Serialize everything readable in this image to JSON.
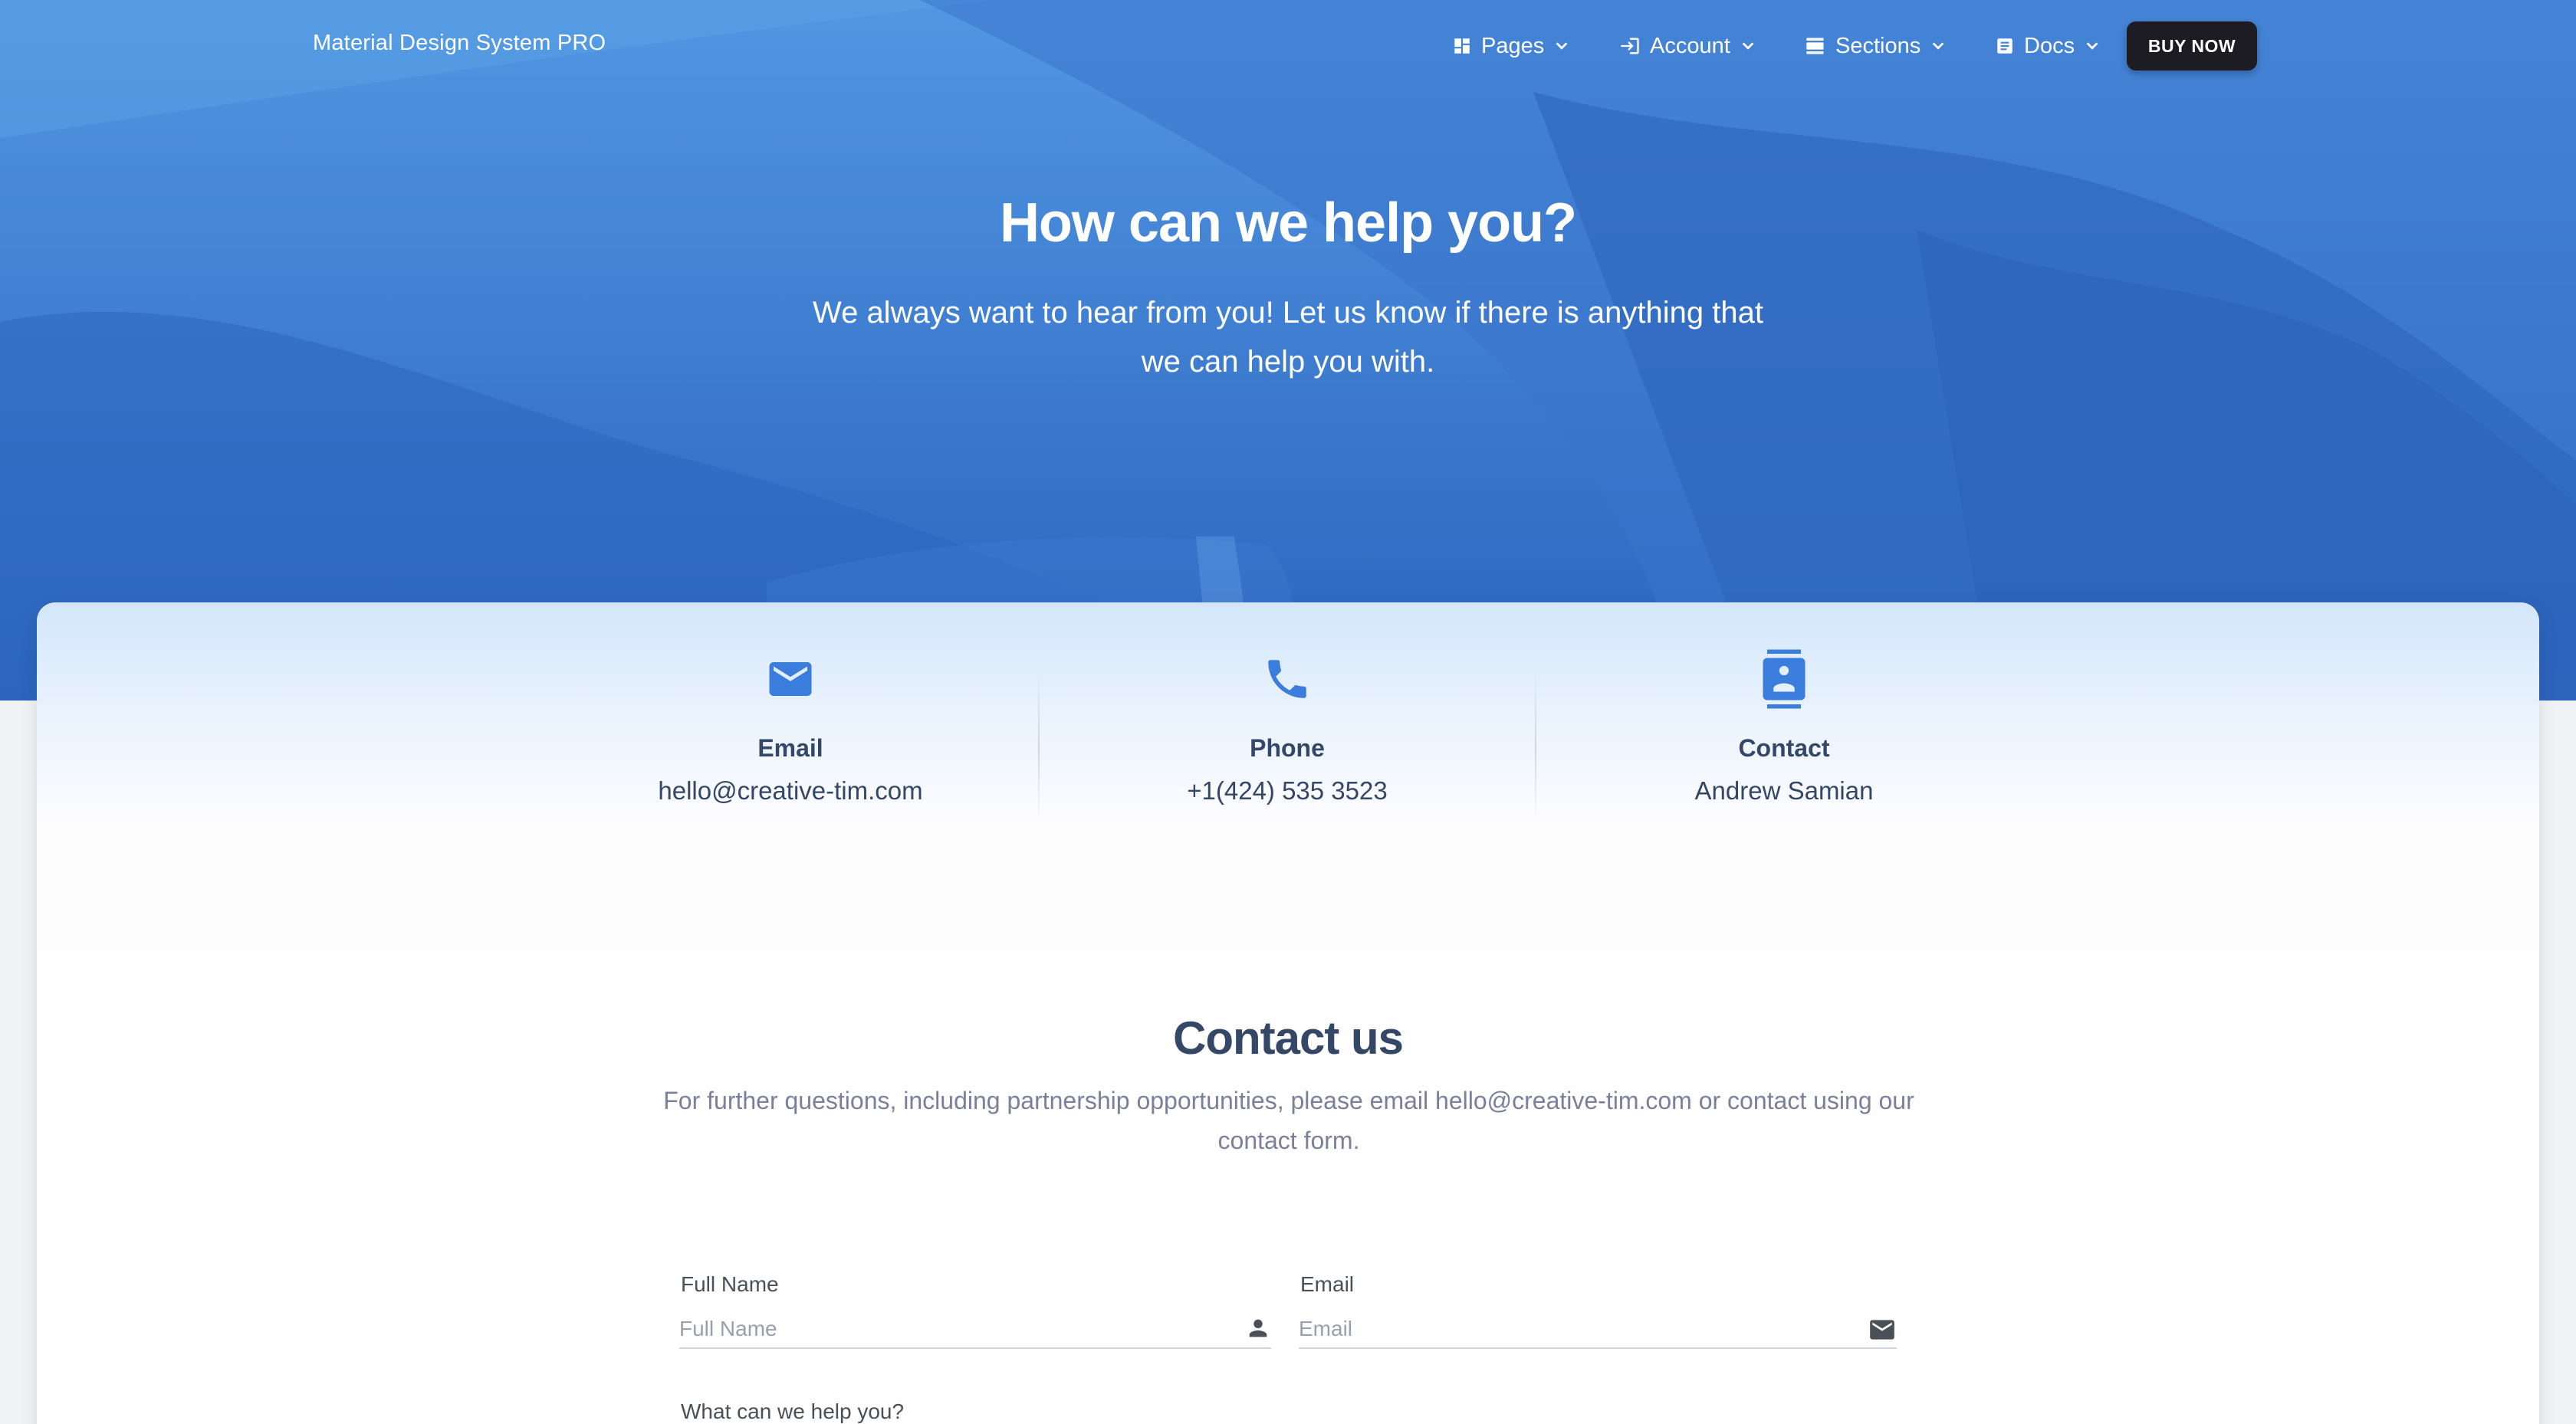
{
  "navbar": {
    "brand": "Material Design System PRO",
    "items": [
      {
        "label": "Pages",
        "icon": "dashboard-icon"
      },
      {
        "label": "Account",
        "icon": "login-icon"
      },
      {
        "label": "Sections",
        "icon": "view-day-icon"
      },
      {
        "label": "Docs",
        "icon": "article-icon"
      }
    ],
    "buy_label": "BUY NOW"
  },
  "hero": {
    "title": "How can we help you?",
    "subtitle": "We always want to hear from you! Let us know if there is anything that we can help you with."
  },
  "info": [
    {
      "title": "Email",
      "value": "hello@creative-tim.com",
      "icon": "email-icon"
    },
    {
      "title": "Phone",
      "value": "+1(424) 535 3523",
      "icon": "phone-icon"
    },
    {
      "title": "Contact",
      "value": "Andrew Samian",
      "icon": "contact-card-icon"
    }
  ],
  "contact": {
    "title": "Contact us",
    "subtitle": "For further questions, including partnership opportunities, please email hello@creative-tim.com or contact using our contact form."
  },
  "form": {
    "full_name": {
      "label": "Full Name",
      "placeholder": "Full Name",
      "value": ""
    },
    "email": {
      "label": "Email",
      "placeholder": "Email",
      "value": ""
    },
    "message": {
      "label": "What can we help you?"
    }
  },
  "colors": {
    "accent_blue": "#3b7ddd",
    "text_dark": "#344767",
    "text_muted": "#7b809a",
    "button_dark": "#1c1c22"
  }
}
